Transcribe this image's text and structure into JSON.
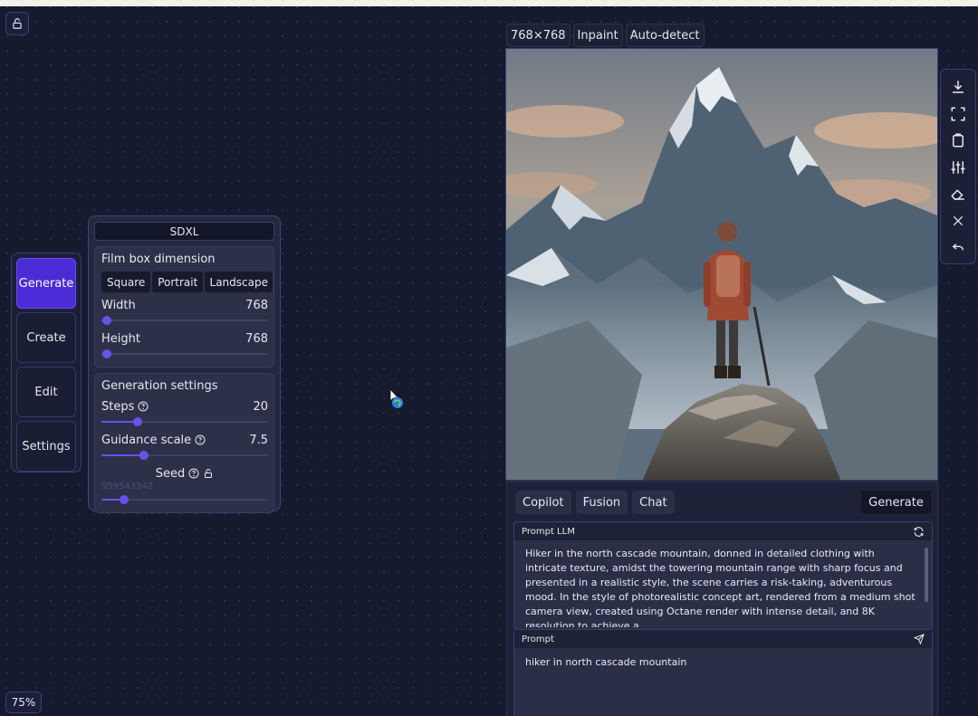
{
  "zoom": "75%",
  "nav": {
    "items": [
      {
        "label": "Generate",
        "active": true
      },
      {
        "label": "Create",
        "active": false
      },
      {
        "label": "Edit",
        "active": false
      },
      {
        "label": "Settings",
        "active": false
      }
    ]
  },
  "panel": {
    "model": "SDXL",
    "dimension": {
      "title": "Film box dimension",
      "options": [
        "Square",
        "Portrait",
        "Landscape"
      ],
      "width_label": "Width",
      "width_value": "768",
      "width_fraction": 0.0,
      "height_label": "Height",
      "height_value": "768",
      "height_fraction": 0.0
    },
    "generation": {
      "title": "Generation settings",
      "steps_label": "Steps",
      "steps_value": "20",
      "steps_fraction": 0.2,
      "guidance_label": "Guidance scale",
      "guidance_value": "7.5",
      "guidance_fraction": 0.24,
      "seed_label": "Seed",
      "seed_value": "959543342",
      "seed_fraction": 0.11
    }
  },
  "image": {
    "tags": [
      "768×768",
      "Inpaint",
      "Auto-detect"
    ]
  },
  "toolbar": {
    "tools": [
      "download-icon",
      "fullscreen-icon",
      "trash-icon",
      "sliders-icon",
      "eraser-icon",
      "close-icon",
      "undo-icon"
    ]
  },
  "prompt_panel": {
    "tabs": [
      "Copilot",
      "Fusion",
      "Chat"
    ],
    "generate_label": "Generate",
    "llm_label": "Prompt LLM",
    "llm_text": "Hiker in the north cascade mountain, donned in detailed clothing with intricate texture, amidst the towering mountain range with sharp focus and presented in a realistic style, the scene carries a risk-taking, adventurous mood. In the style of photorealistic concept art, rendered from a medium shot camera view, created using Octane render with intense detail, and 8K resolution to achieve a",
    "prompt_label": "Prompt",
    "prompt_text": "hiker in north cascade mountain"
  },
  "colors": {
    "accent": "#4b2bd6",
    "slider": "#6a52e8",
    "background": "#151a2e"
  }
}
